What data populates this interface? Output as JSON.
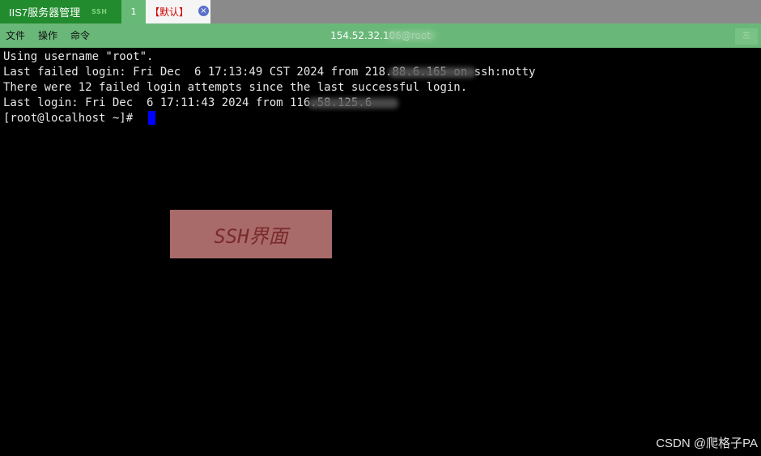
{
  "app": {
    "title": "IIS7服务器管理",
    "badge": "SSH"
  },
  "tabs": {
    "number": "1",
    "default_label": "【默认】",
    "close_glyph": "×"
  },
  "menu": {
    "items": [
      "文件",
      "操作",
      "命令"
    ],
    "right_button": "左"
  },
  "session": {
    "title": "154.52.32.106@root"
  },
  "terminal": {
    "lines": [
      "Using username \"root\".",
      "Last failed login: Fri Dec  6 17:13:49 CST 2024 from 218.88.6.165 on ssh:notty",
      "There were 12 failed login attempts since the last successful login.",
      "Last login: Fri Dec  6 17:11:43 2024 from 116.58.125.6",
      "[root@localhost ~]# "
    ]
  },
  "overlay": {
    "label": "SSH界面"
  },
  "watermark": "CSDN @爬格子PA",
  "colors": {
    "app_tab": "#218b2d",
    "menu_bar": "#6ab879",
    "tab_bar": "#8a8a8a",
    "terminal_bg": "#000000",
    "cursor": "#0000ff",
    "default_tab_text": "#d40000"
  }
}
